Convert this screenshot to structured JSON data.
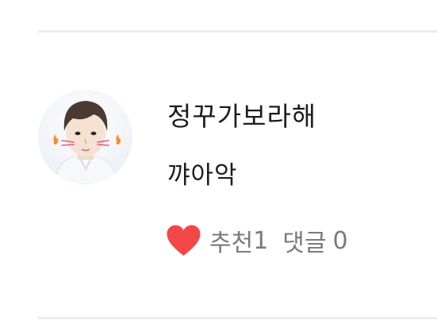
{
  "post": {
    "author": "정꾸가보라해",
    "text": "꺄아악",
    "recommend_label": "추천",
    "recommend_count": "1",
    "comment_label": "댓글",
    "comment_count": "0"
  },
  "colors": {
    "heart": "#f44747",
    "divider": "#ececec",
    "meta_text": "#7a7a7a",
    "text": "#1d1d1d"
  },
  "icons": {
    "heart": "heart-icon",
    "avatar": "profile-avatar"
  }
}
